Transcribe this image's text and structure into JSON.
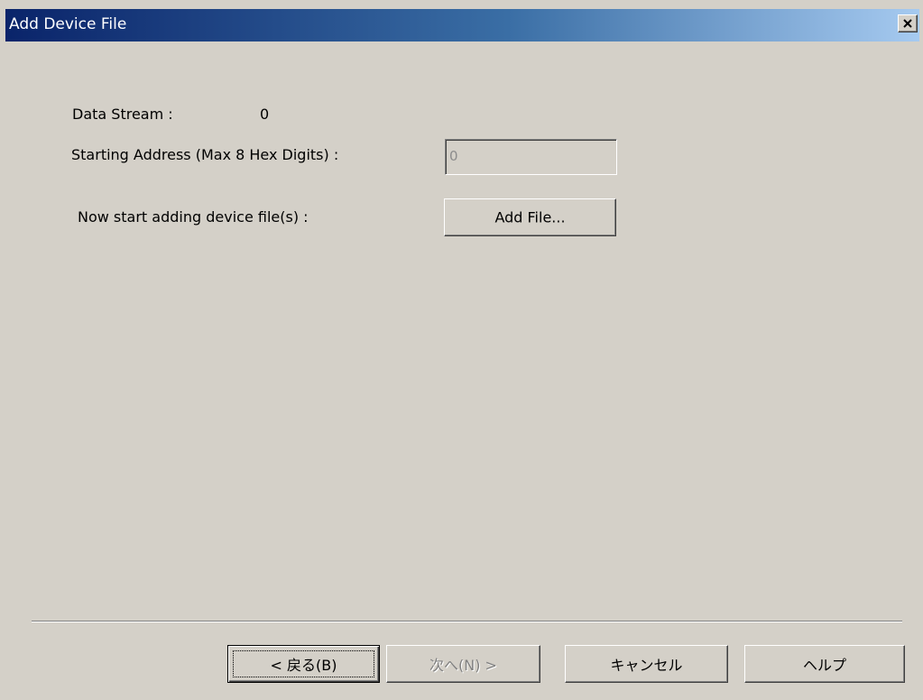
{
  "window": {
    "title": "Add Device File"
  },
  "form": {
    "data_stream_label": "Data Stream :",
    "data_stream_value": "0",
    "starting_address_label": "Starting Address (Max 8 Hex Digits) :",
    "starting_address_value": "0",
    "start_adding_label": "Now start adding device file(s) :",
    "add_file_button": "Add File..."
  },
  "footer": {
    "back_button": "< 戻る(B)",
    "next_button": "次へ(N) >",
    "cancel_button": "キャンセル",
    "help_button": "ヘルプ"
  },
  "colors": {
    "dialog_face": "#d4d0c8",
    "title_gradient_start": "#0a246a",
    "title_gradient_end": "#a6caf0",
    "disabled_text": "#808080"
  },
  "icons": {
    "close": "close-icon"
  }
}
